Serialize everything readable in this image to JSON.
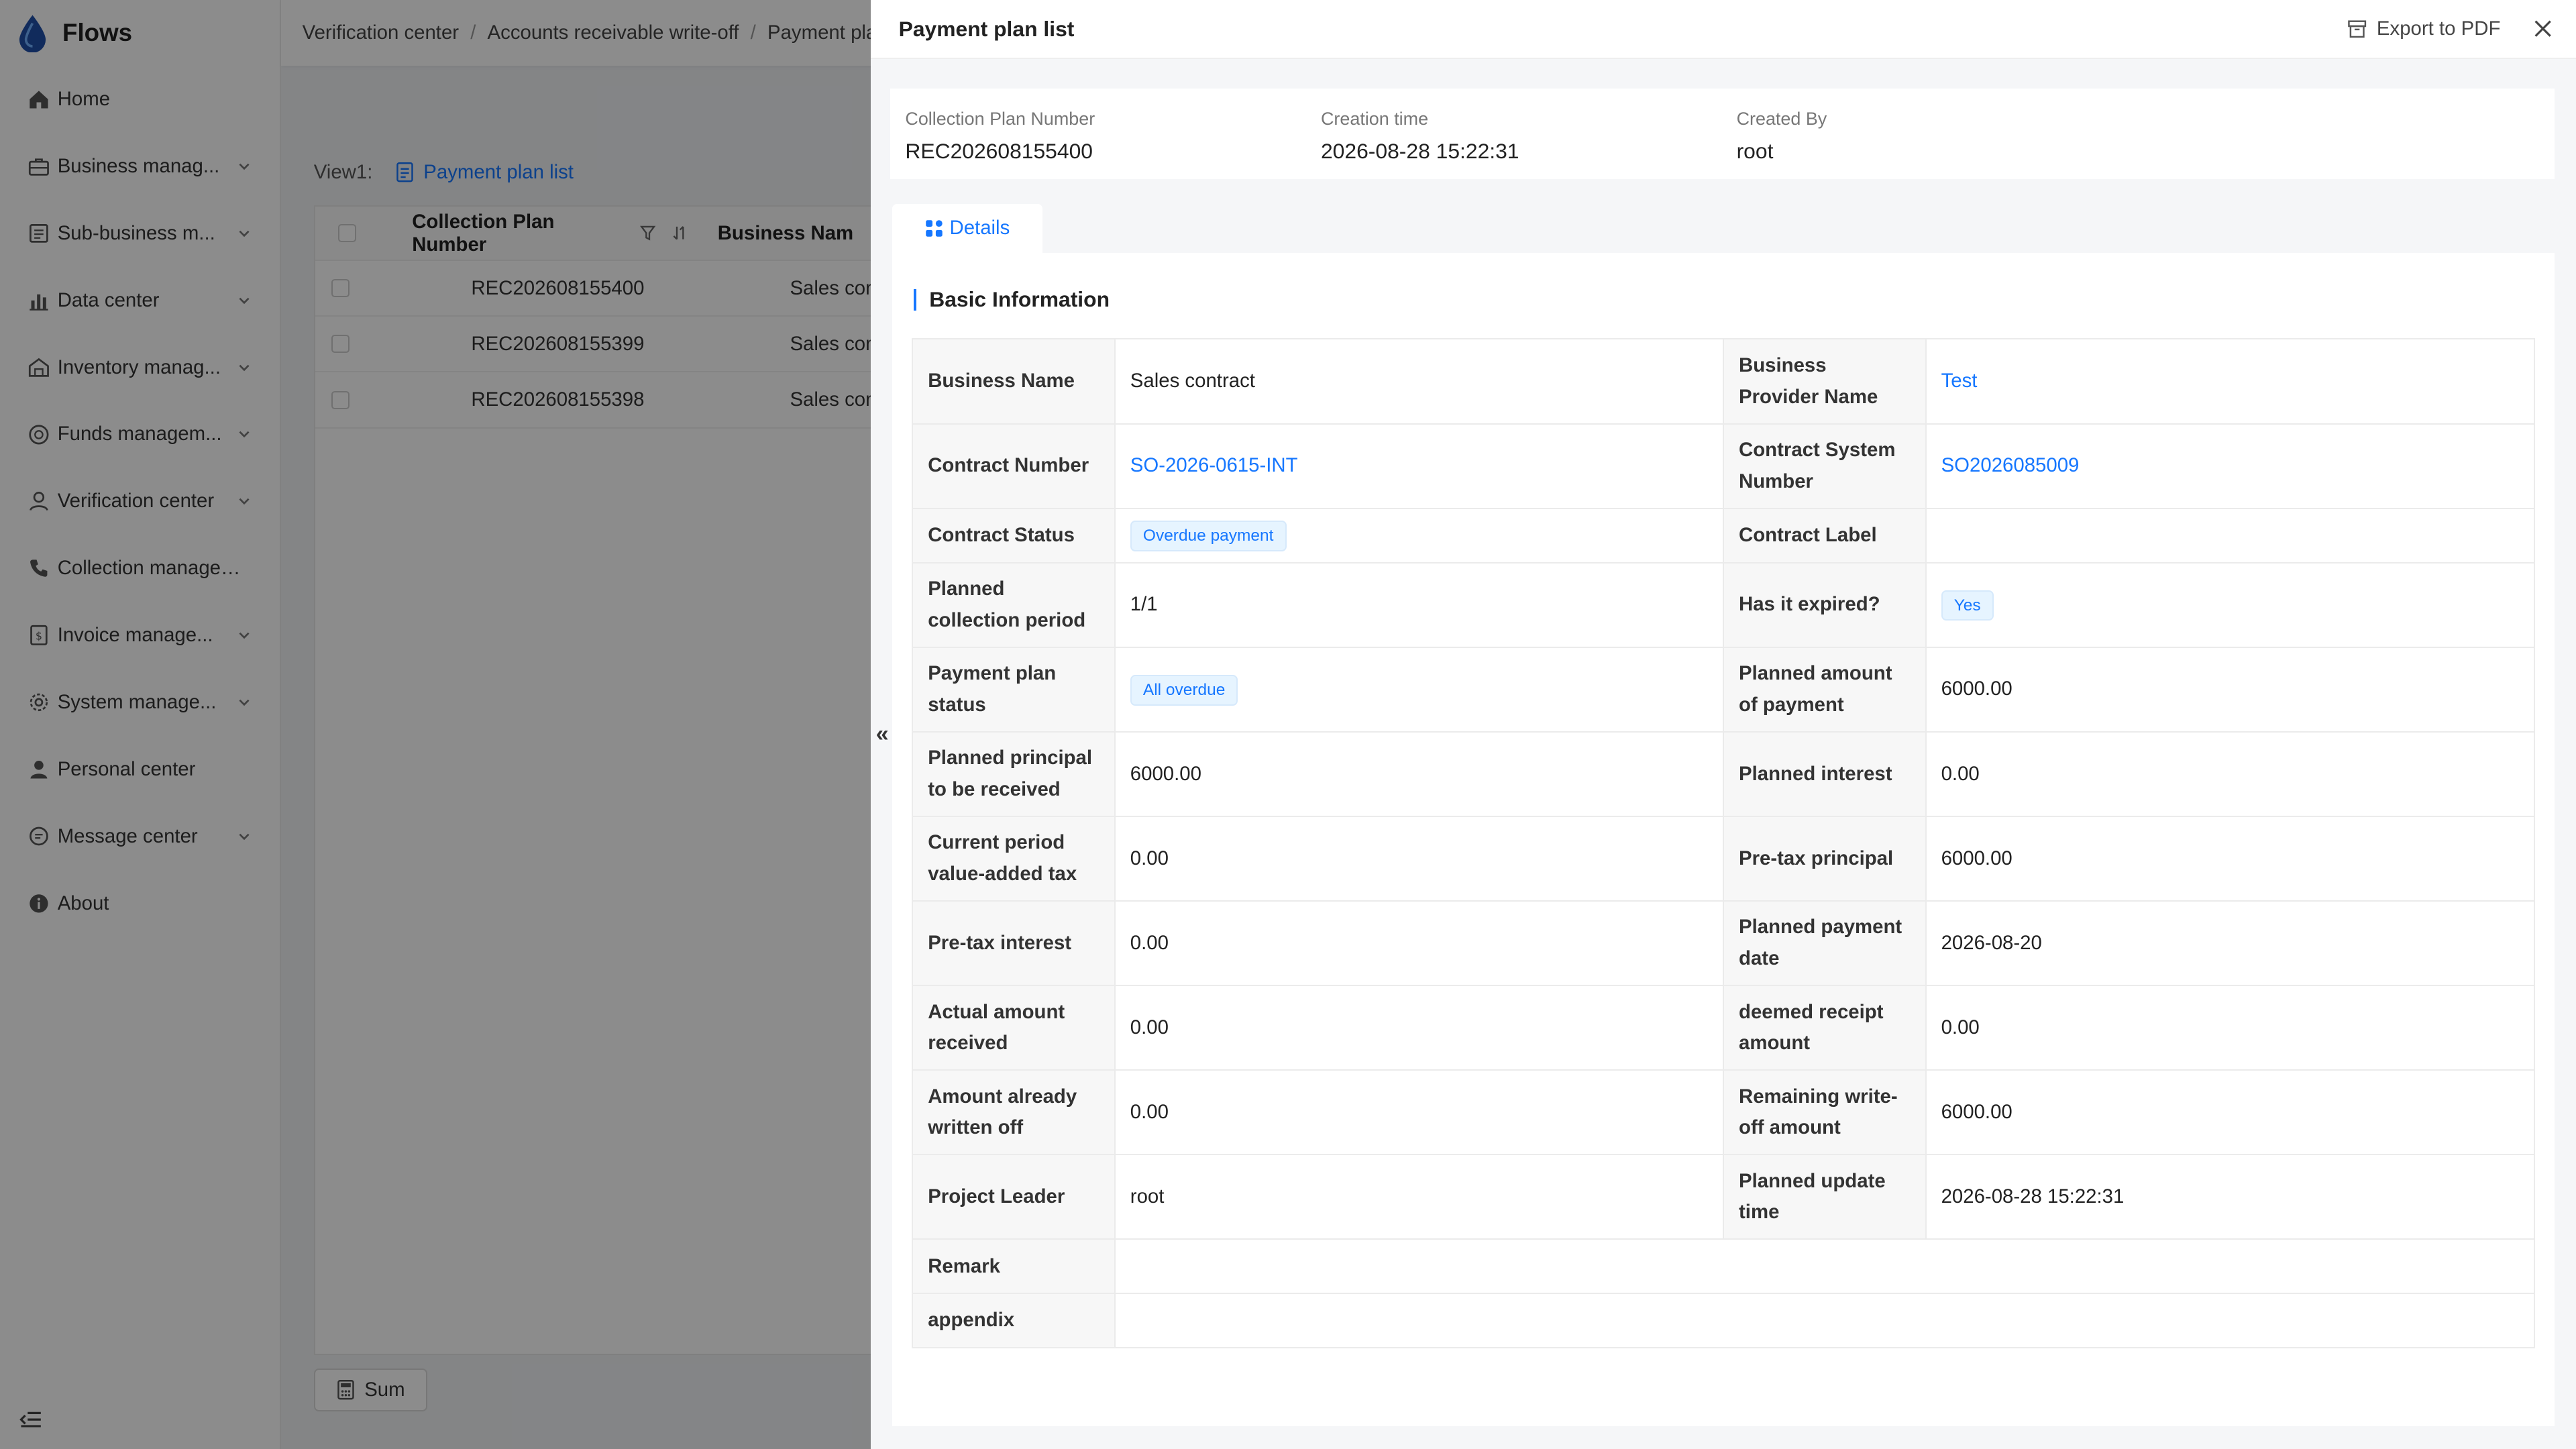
{
  "app": {
    "name": "Flows"
  },
  "sidebar": {
    "items": [
      {
        "label": "Home",
        "icon": "home-icon",
        "has_chevron": false
      },
      {
        "label": "Business manag...",
        "icon": "briefcase-icon",
        "has_chevron": true
      },
      {
        "label": "Sub-business m...",
        "icon": "document-icon",
        "has_chevron": true
      },
      {
        "label": "Data center",
        "icon": "bar-chart-icon",
        "has_chevron": true
      },
      {
        "label": "Inventory manag...",
        "icon": "warehouse-icon",
        "has_chevron": true
      },
      {
        "label": "Funds managem...",
        "icon": "coin-icon",
        "has_chevron": true
      },
      {
        "label": "Verification center",
        "icon": "user-check-icon",
        "has_chevron": true
      },
      {
        "label": "Collection managem...",
        "icon": "phone-icon",
        "has_chevron": false
      },
      {
        "label": "Invoice manage...",
        "icon": "invoice-icon",
        "has_chevron": true
      },
      {
        "label": "System manage...",
        "icon": "gear-icon",
        "has_chevron": true
      },
      {
        "label": "Personal center",
        "icon": "person-icon",
        "has_chevron": false
      },
      {
        "label": "Message center",
        "icon": "message-icon",
        "has_chevron": true
      },
      {
        "label": "About",
        "icon": "info-icon",
        "has_chevron": false
      }
    ]
  },
  "breadcrumb": [
    "Verification center",
    "Accounts receivable write-off",
    "Payment plan"
  ],
  "background_list": {
    "view_label": "View1:",
    "view_link": "Payment plan list",
    "columns": [
      "Collection Plan Number",
      "Business Nam"
    ],
    "rows": [
      [
        "REC202608155400",
        "Sales cont"
      ],
      [
        "REC202608155399",
        "Sales cont"
      ],
      [
        "REC202608155398",
        "Sales cont"
      ]
    ],
    "sum_button": "Sum"
  },
  "drawer": {
    "title": "Payment plan list",
    "export_label": "Export to PDF",
    "expand_glyph": "«",
    "summary": [
      {
        "label": "Collection Plan Number",
        "value": "REC202608155400"
      },
      {
        "label": "Creation time",
        "value": "2026-08-28 15:22:31"
      },
      {
        "label": "Created By",
        "value": "root"
      }
    ],
    "tab": "Details",
    "section_title": "Basic Information",
    "fields": {
      "business_name": {
        "label": "Business Name",
        "value": "Sales contract"
      },
      "business_provider_name": {
        "label": "Business Provider Name",
        "value": "Test"
      },
      "contract_number": {
        "label": "Contract Number",
        "value": "SO-2026-0615-INT"
      },
      "contract_system_number": {
        "label": "Contract System Number",
        "value": "SO2026085009"
      },
      "contract_status": {
        "label": "Contract Status",
        "value": "Overdue payment"
      },
      "contract_label": {
        "label": "Contract Label",
        "value": ""
      },
      "planned_collection_period": {
        "label": "Planned collection period",
        "value": "1/1"
      },
      "has_expired": {
        "label": "Has it expired?",
        "value": "Yes"
      },
      "payment_plan_status": {
        "label": "Payment plan status",
        "value": "All overdue"
      },
      "planned_amount_of_payment": {
        "label": "Planned amount of payment",
        "value": "6000.00"
      },
      "planned_principal": {
        "label": "Planned principal to be received",
        "value": "6000.00"
      },
      "planned_interest": {
        "label": "Planned interest",
        "value": "0.00"
      },
      "current_period_vat": {
        "label": "Current period value-added tax",
        "value": "0.00"
      },
      "pretax_principal": {
        "label": "Pre-tax principal",
        "value": "6000.00"
      },
      "pretax_interest": {
        "label": "Pre-tax interest",
        "value": "0.00"
      },
      "planned_payment_date": {
        "label": "Planned payment date",
        "value": "2026-08-20"
      },
      "actual_amount_received": {
        "label": "Actual amount received",
        "value": "0.00"
      },
      "deemed_receipt_amount": {
        "label": "deemed receipt amount",
        "value": "0.00"
      },
      "amount_written_off": {
        "label": "Amount already written off",
        "value": "0.00"
      },
      "remaining_writeoff": {
        "label": "Remaining write-off amount",
        "value": "6000.00"
      },
      "project_leader": {
        "label": "Project Leader",
        "value": "root"
      },
      "planned_update_time": {
        "label": "Planned update time",
        "value": "2026-08-28 15:22:31"
      },
      "remark": {
        "label": "Remark",
        "value": ""
      },
      "appendix": {
        "label": "appendix",
        "value": ""
      }
    }
  },
  "colors": {
    "accent": "#1677ff",
    "overlay": "rgba(0,0,0,0.45)"
  }
}
